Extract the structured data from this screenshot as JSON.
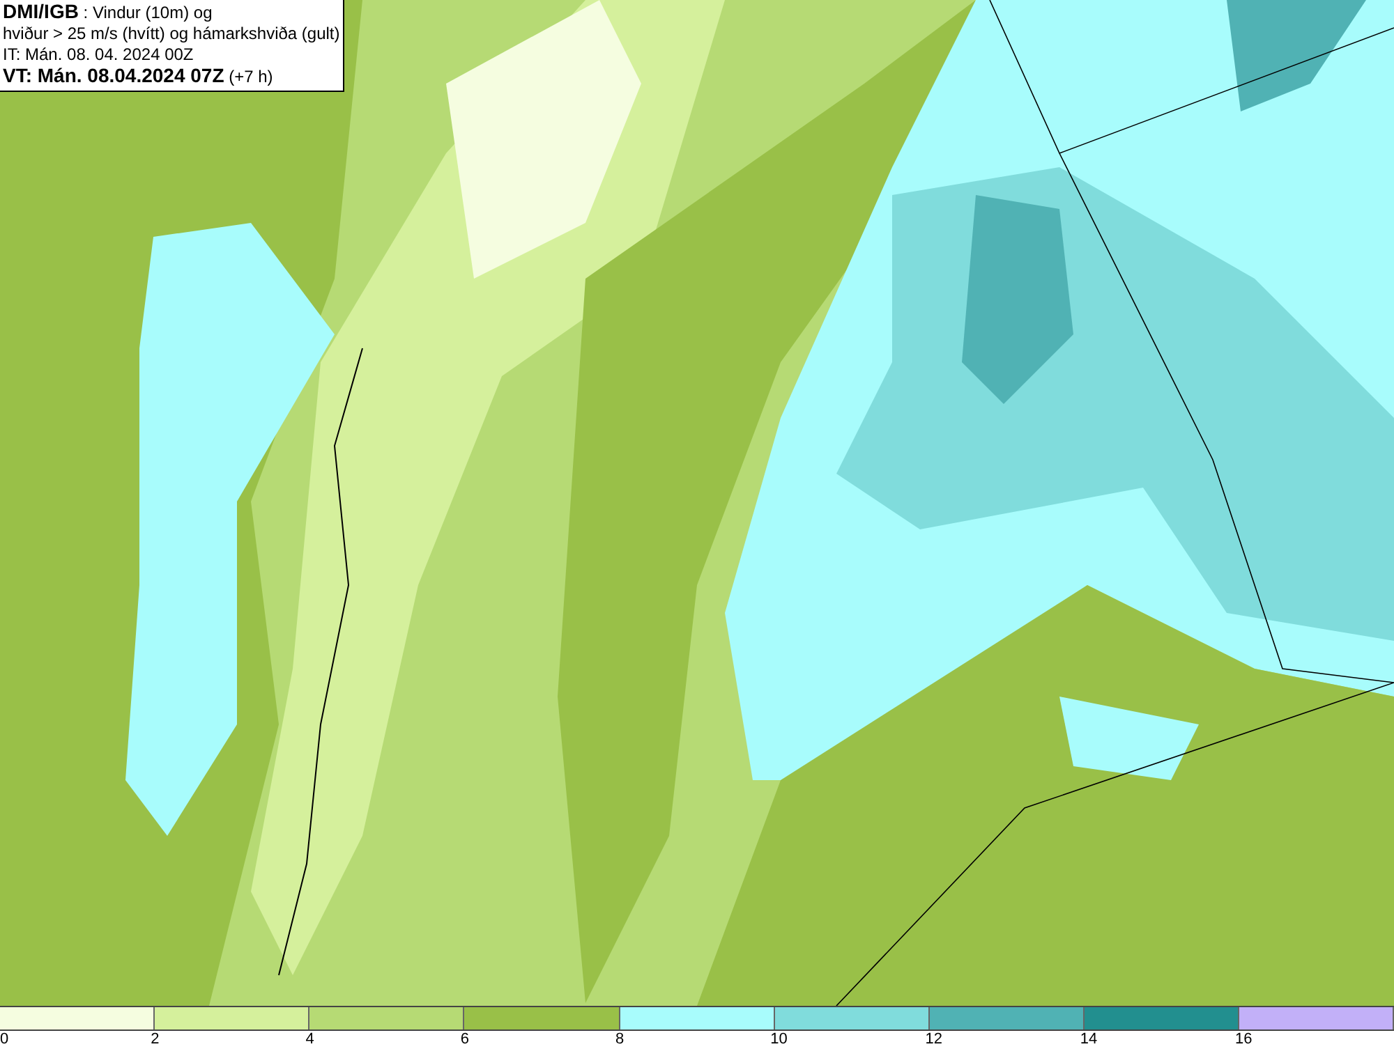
{
  "info_box": {
    "lines": [
      "**DMI/IGB** : Vindur (10m) og",
      "hviður > 25 m/s (hvítt) og hámarkshviða (gult)",
      "IT: Mán. 08. 04. 2024 00Z",
      "**VT: Mán. 08.04.2024 07Z** (+7 h)"
    ]
  },
  "legend": {
    "segments": [
      {
        "label": "0",
        "color": "#f5fde0"
      },
      {
        "label": "2",
        "color": "#d5f09c"
      },
      {
        "label": "4",
        "color": "#b6da74"
      },
      {
        "label": "6",
        "color": "#99c048"
      },
      {
        "label": "8",
        "color": "#a8fcfc"
      },
      {
        "label": "10",
        "color": "#80dcdc"
      },
      {
        "label": "12",
        "color": "#50b2b4"
      },
      {
        "label": "14",
        "color": "#228f8f"
      },
      {
        "label": "16",
        "color": "#c2b0f8"
      }
    ]
  }
}
